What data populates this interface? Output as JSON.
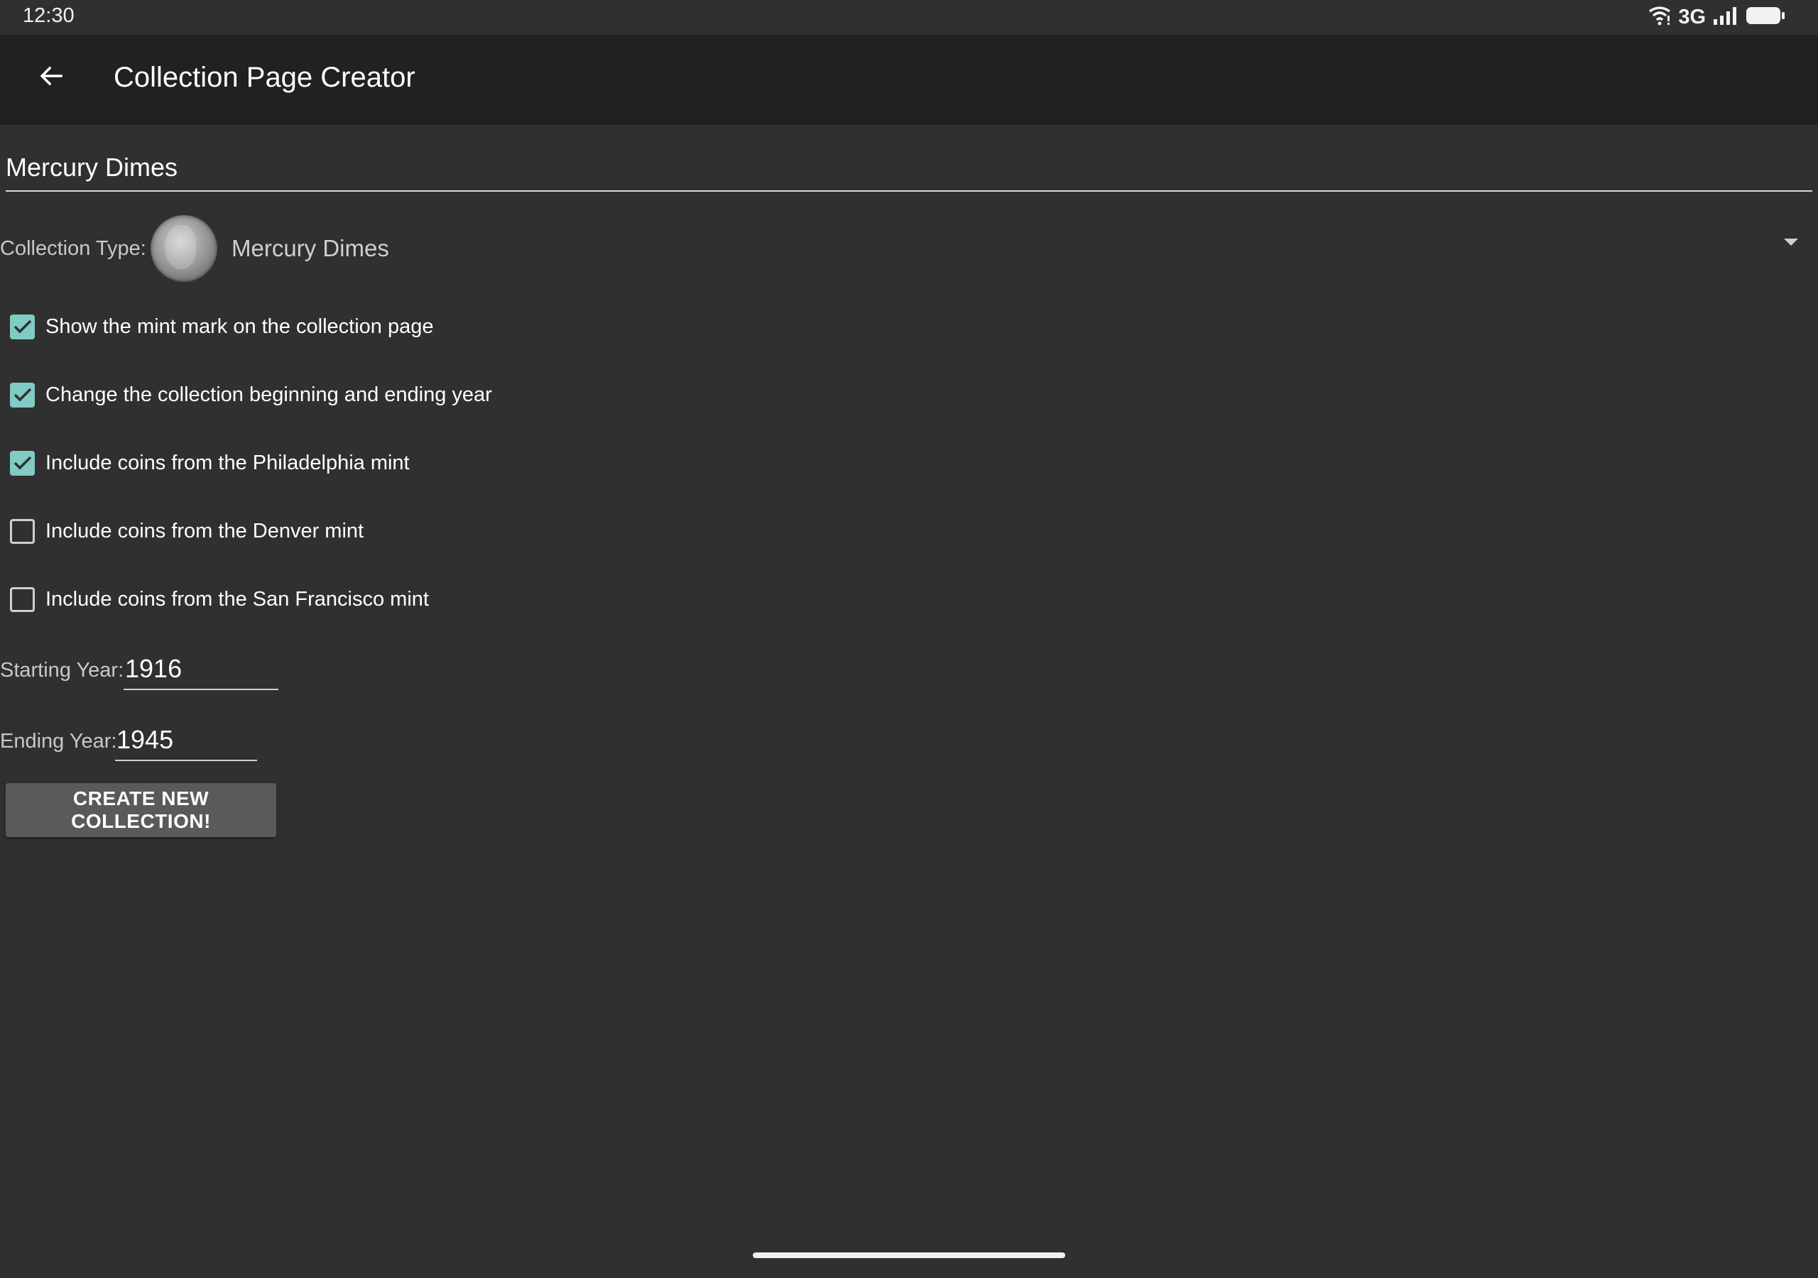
{
  "status_bar": {
    "time": "12:30",
    "network_label": "3G",
    "icons": [
      "wifi-icon",
      "cellular-signal-icon",
      "battery-icon"
    ]
  },
  "app_bar": {
    "title": "Collection Page Creator",
    "back_icon": "arrow-left-icon"
  },
  "form": {
    "collection_name": "Mercury Dimes",
    "collection_type_label": "Collection Type:",
    "collection_type_value": "Mercury Dimes",
    "options": [
      {
        "label": "Show the mint mark on the collection page",
        "checked": true
      },
      {
        "label": "Change the collection beginning and ending year",
        "checked": true
      },
      {
        "label": "Include coins from the Philadelphia mint",
        "checked": true
      },
      {
        "label": "Include coins from the Denver mint",
        "checked": false
      },
      {
        "label": "Include coins from the San Francisco mint",
        "checked": false
      }
    ],
    "starting_year_label": "Starting Year:",
    "starting_year_value": "1916",
    "ending_year_label": "Ending Year:",
    "ending_year_value": "1945",
    "create_button_label": "CREATE NEW COLLECTION!"
  },
  "colors": {
    "background": "#303030",
    "app_bar": "#212121",
    "accent": "#80cbc4",
    "button": "#5a5a5a"
  }
}
